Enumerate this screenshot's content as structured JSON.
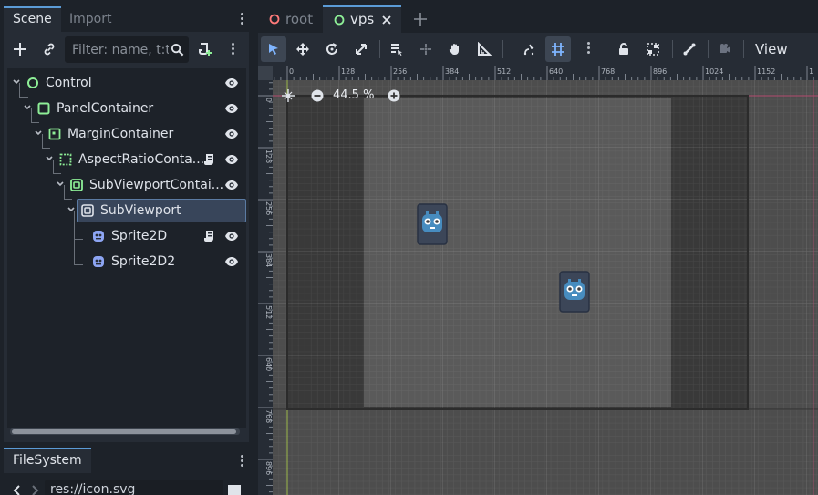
{
  "left_dock": {
    "tabs": [
      {
        "label": "Scene",
        "active": true
      },
      {
        "label": "Import",
        "active": false
      }
    ],
    "filter": {
      "placeholder": "Filter: name, t:t"
    },
    "tree": [
      {
        "label": "Control",
        "icon": "control-circle-icon",
        "depth": 0,
        "script": false
      },
      {
        "label": "PanelContainer",
        "icon": "panel-container-icon",
        "depth": 1,
        "script": false
      },
      {
        "label": "MarginContainer",
        "icon": "margin-container-icon",
        "depth": 2,
        "script": false
      },
      {
        "label": "AspectRatioConta...",
        "icon": "aspect-ratio-container-icon",
        "depth": 3,
        "script": true
      },
      {
        "label": "SubViewportContai...",
        "icon": "subviewport-container-icon",
        "depth": 4,
        "script": false
      },
      {
        "label": "SubViewport",
        "icon": "subviewport-icon",
        "depth": 5,
        "script": false,
        "selected": true
      },
      {
        "label": "Sprite2D",
        "icon": "sprite2d-icon",
        "depth": 6,
        "script": true
      },
      {
        "label": "Sprite2D2",
        "icon": "sprite2d-icon",
        "depth": 6,
        "script": false
      }
    ],
    "filesystem": {
      "tab_label": "FileSystem",
      "path": "res://icon.svg"
    }
  },
  "main": {
    "scene_tabs": [
      {
        "label": "root",
        "active": false,
        "icon": "unsaved-circle-icon"
      },
      {
        "label": "vps",
        "active": true,
        "icon": "scene-circle-icon"
      }
    ],
    "toolbar": {
      "view_label": "View"
    },
    "zoom": {
      "value": "44.5 %"
    },
    "ruler_top_labels": [
      "0",
      "128",
      "256",
      "384",
      "512",
      "640",
      "768",
      "896",
      "1024",
      "1152",
      "1"
    ],
    "ruler_left_labels": [
      "0",
      "128",
      "256",
      "384",
      "512",
      "640",
      "768",
      "896"
    ]
  },
  "colors": {
    "accent": "#5b9bd6",
    "node_green": "#8eef97",
    "sprite_blue": "#8da5f3",
    "panel_bg": "#262c35"
  }
}
